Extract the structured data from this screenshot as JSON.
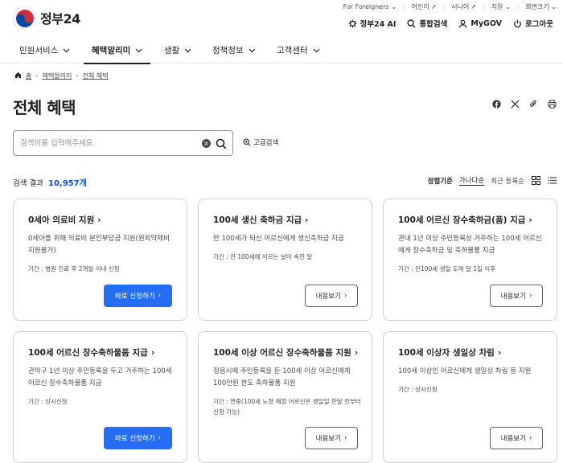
{
  "header": {
    "logo_text": "정부24",
    "util_top": [
      "For Foreigners ⌄",
      "어린이",
      "시니어",
      "지원 ⌄",
      "화면크기 ⌄"
    ],
    "util_bottom": [
      "정부24 AI",
      "통합검색",
      "MyGOV",
      "로그아웃"
    ]
  },
  "gnb": {
    "items": [
      {
        "label": "민원서비스"
      },
      {
        "label": "혜택알리미"
      },
      {
        "label": "생활"
      },
      {
        "label": "정책정보"
      },
      {
        "label": "고객센터"
      }
    ]
  },
  "breadcrumb": [
    "홈",
    "혜택알리미",
    "전체 혜택"
  ],
  "page_title": "전체 혜택",
  "search": {
    "placeholder": "검색어를 입력해주세요.",
    "value": "",
    "advanced_label": "고급검색"
  },
  "results": {
    "label": "검색 결과",
    "count": "10,957개"
  },
  "sort": {
    "label": "정렬기준",
    "options": [
      "가나다순",
      "최근 등록순"
    ]
  },
  "cards": [
    {
      "title": "0세아 의료비 지원",
      "desc": "0세아를 위해 의료비 본인부담금 지원(원외약제비 지원불가)",
      "period": "기간 : 병원 진료 후 2개월 이내 신청",
      "button": "바로 신청하기"
    },
    {
      "title": "100세 생신 축하금 지급",
      "desc": "만 100세가 되신 어르신에게 생신축하금 지급",
      "period": "기간 : 만 100세에 이르는 날이 속한 달",
      "button": "내용보기"
    },
    {
      "title": "100세 어르신 장수축하금(품) 지급",
      "desc": "관내 1년 이상 주민등록상 거주하는 100세 어르신에게 장수축하금 및 축하물품 지급",
      "period": "기간 : 만100세 생일 도래 달 1일 이후",
      "button": "내용보기"
    },
    {
      "title": "100세 어르신 장수축하물품 지급",
      "desc": "관악구 1년 이상 주민등록을 두고 거주하는 100세 어르신 장수축하물품 지급",
      "period": "기간 : 상시신청",
      "button": "바로 신청하기"
    },
    {
      "title": "100세 이상 어르신 장수축하물품 지원",
      "desc": "정읍시에 주민등록을 둔 100세 이상 어르신에게 100만원 한도 축하물품 지원",
      "period": "기간 : 연중(100세 노령 예정 어르신은 생일일 한달 전부터 신청 가능)",
      "button": "내용보기"
    },
    {
      "title": "100세 이상자 생일상 차림",
      "desc": "100세 이상인 어르신에게 생일상 차림 등 지원",
      "period": "기간 : 상시신청",
      "button": "내용보기"
    }
  ]
}
